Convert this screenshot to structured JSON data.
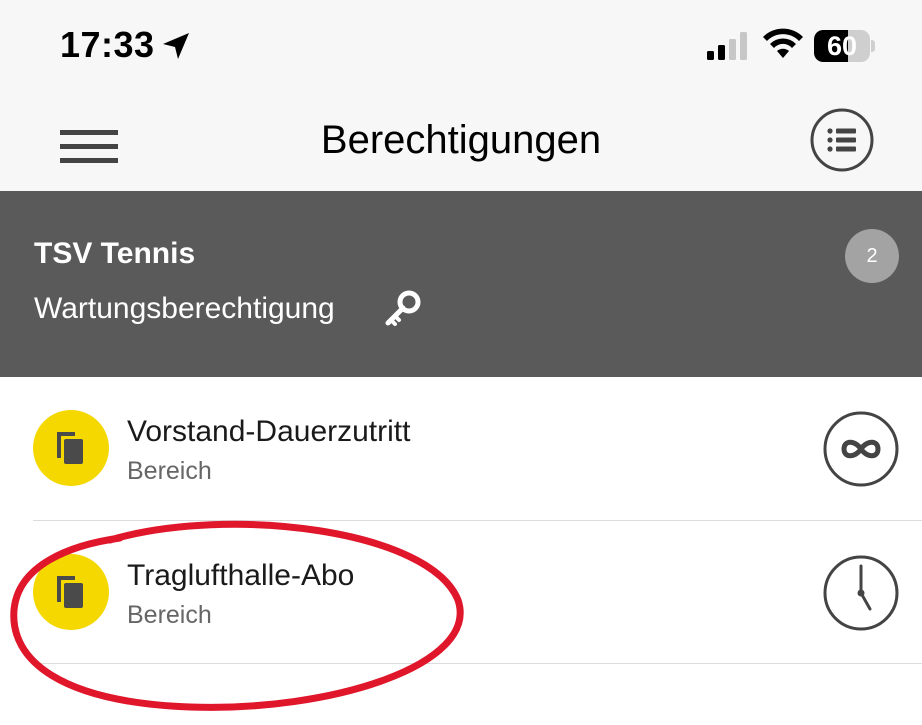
{
  "status_bar": {
    "time": "17:33",
    "battery_level": "60",
    "battery_fraction": 0.6,
    "icons": [
      "location-arrow-icon",
      "cellular-signal-icon",
      "wifi-icon",
      "battery-icon"
    ]
  },
  "nav": {
    "title": "Berechtigungen",
    "left_icon": "hamburger-menu-icon",
    "right_icon": "list-view-icon"
  },
  "org": {
    "name": "TSV Tennis",
    "subtitle": "Wartungsberechtigung",
    "subtitle_icon": "key-icon",
    "count": "2"
  },
  "items": [
    {
      "title": "Vorstand-Dauerzutritt",
      "subtitle": "Bereich",
      "avatar_icon": "copy-area-icon",
      "status_icon": "infinity-icon"
    },
    {
      "title": "Traglufthalle-Abo",
      "subtitle": "Bereich",
      "avatar_icon": "copy-area-icon",
      "status_icon": "clock-icon"
    }
  ],
  "colors": {
    "header_bg": "#f7f7f7",
    "org_panel_bg": "#5a5a5a",
    "badge_bg": "#a3a3a3",
    "avatar_yellow": "#f5d800",
    "annotation_red": "#e0162b",
    "divider": "#dcdcdc"
  }
}
